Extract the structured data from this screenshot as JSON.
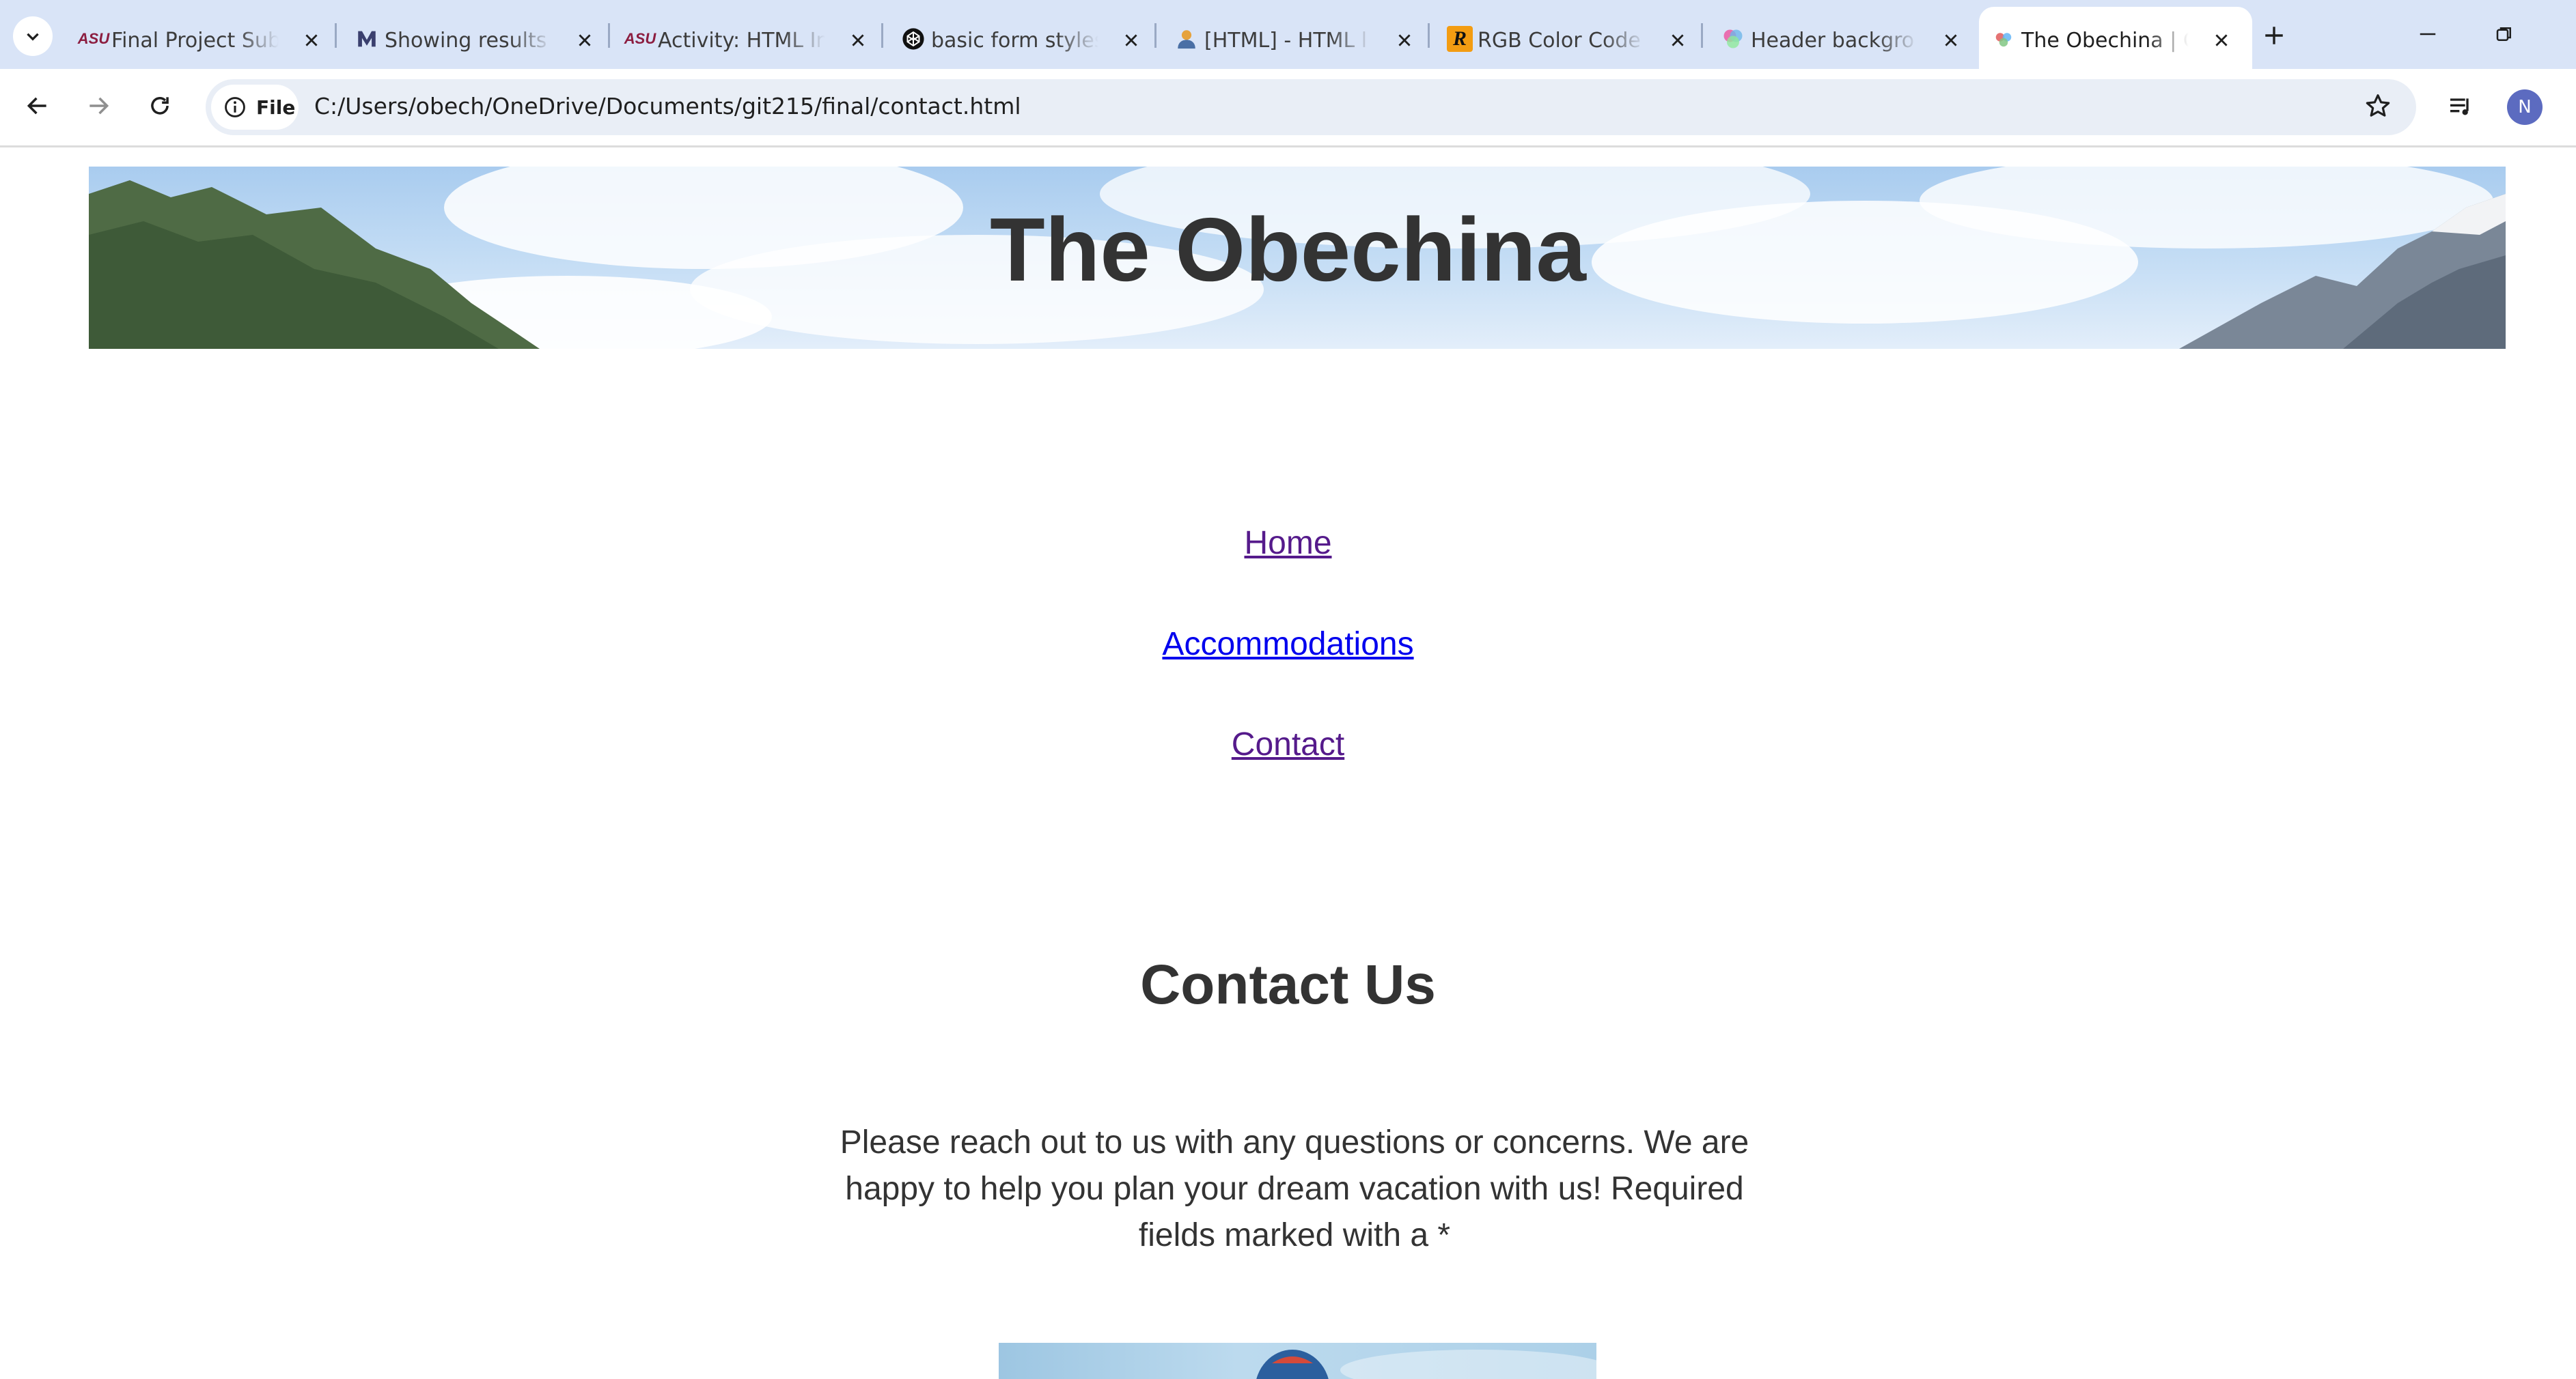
{
  "browser": {
    "tabs": [
      {
        "title": "Final Project Sub",
        "favicon": "asu-logo-icon",
        "active": false
      },
      {
        "title": "Showing results f",
        "favicon": "library-logo-icon",
        "active": false
      },
      {
        "title": "Activity: HTML In",
        "favicon": "asu-logo-icon",
        "active": false
      },
      {
        "title": "basic form styles",
        "favicon": "codepen-icon",
        "active": false
      },
      {
        "title": "[HTML] - HTML l",
        "favicon": "person-icon",
        "active": false
      },
      {
        "title": "RGB Color Code",
        "favicon": "rapidtables-icon",
        "active": false
      },
      {
        "title": "Header backgro",
        "favicon": "gradient-icon",
        "active": false
      },
      {
        "title": "The Obechina | C",
        "favicon": "page-icon",
        "active": true
      }
    ],
    "favicon_labels": {
      "asu": "ASU",
      "rapidtables": "R"
    },
    "file_chip_label": "File",
    "url": "C:/Users/obech/OneDrive/Documents/git215/final/contact.html",
    "profile_initial": "N",
    "colors": {
      "tabbar": "#d9e4f7",
      "omnibox": "#e9eef6",
      "profile": "#5c6bc0"
    }
  },
  "page": {
    "site_title": "The Obechina",
    "nav": [
      {
        "label": "Home",
        "state": "visited"
      },
      {
        "label": "Accommodations",
        "state": "link"
      },
      {
        "label": "Contact",
        "state": "visited"
      }
    ],
    "heading": "Contact Us",
    "intro": "Please reach out to us with any questions or concerns. We are happy to help you plan your dream vacation with us! Required fields marked with a *",
    "colors": {
      "text": "#333333",
      "link": "#0000ee",
      "visited": "#551a8b"
    }
  }
}
